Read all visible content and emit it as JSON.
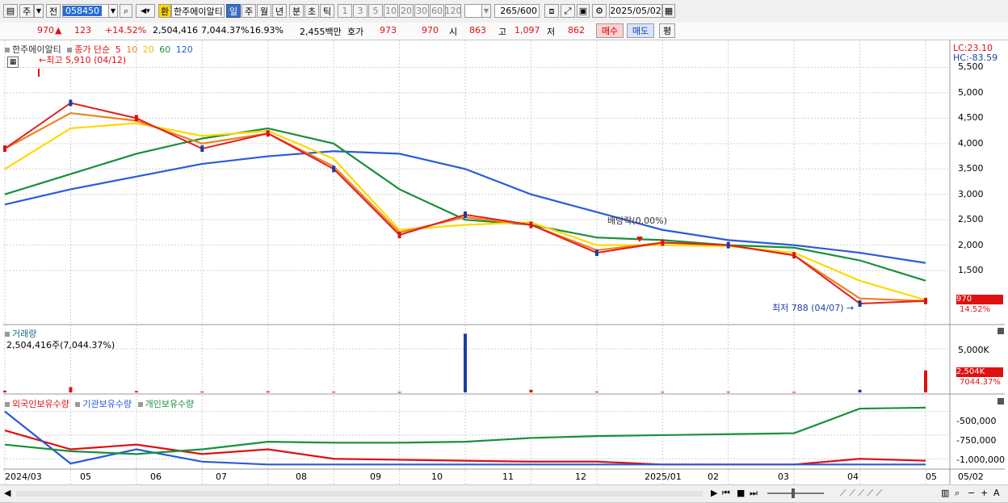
{
  "toolbar": {
    "tab_chart_type": "주",
    "prefix": "전",
    "stock_code": "058450",
    "currency_toggle": "환",
    "stock_name": "한주에이알티",
    "periods": [
      "일",
      "주",
      "월",
      "년",
      "분",
      "초",
      "틱"
    ],
    "selected_period": "일",
    "minute_options": [
      "1",
      "3",
      "5",
      "10",
      "20",
      "30",
      "60",
      "120"
    ],
    "count_value": "265",
    "count_max": "/600",
    "date": "2025/05/02"
  },
  "info": {
    "price": "970",
    "change_arrow": "▲",
    "change": "123",
    "change_pct": "+14.52%",
    "volume": "2,504,416",
    "volume_pct": "7,044.37%",
    "turnover": "16.93%",
    "amount": "2,455백만",
    "quote_label": "호가",
    "ask": "973",
    "bid": "970",
    "open_label": "시",
    "open": "863",
    "high_label": "고",
    "high": "1,097",
    "low_label": "저",
    "low": "862",
    "buy_btn": "매수",
    "sell_btn": "매도",
    "eval_btn": "평"
  },
  "price_panel": {
    "title": "한주에이알티",
    "legend_prefix": "종가 단순",
    "ma_labels": [
      "5",
      "10",
      "20",
      "60",
      "120"
    ],
    "ma_colors": [
      "#e02020",
      "#f08020",
      "#ffd800",
      "#18903a",
      "#2a5adc"
    ],
    "lc_label": "LC:23.10",
    "hc_label": "HC:-83.59",
    "high_annotation": "최고 5,910 (04/12)",
    "low_annotation": "최저 788 (04/07)",
    "dividend_annotation": "배당락(0.00%)",
    "current_price_tag": "970",
    "current_pct_tag": "14.52%",
    "y_ticks": [
      "5,500",
      "5,000",
      "4,500",
      "4,000",
      "3,500",
      "3,000",
      "2,500",
      "2,000",
      "1,500"
    ]
  },
  "volume_panel": {
    "title": "거래량",
    "summary": "2,504,416주(7,044.37%)",
    "y_tick": "5,000K",
    "tag_value": "2,504K",
    "tag_pct": "7044.37%"
  },
  "holding_panel": {
    "legend": [
      "외국인보유수량",
      "기관보유수량",
      "개인보유수량"
    ],
    "legend_colors": [
      "#e01010",
      "#2a5adc",
      "#18903a"
    ],
    "y_ticks": [
      "-500,000",
      "-750,000",
      "-1,000,000"
    ]
  },
  "x_axis": {
    "labels": [
      "2024/03",
      "05",
      "06",
      "07",
      "08",
      "09",
      "10",
      "11",
      "12",
      "2025/01",
      "02",
      "03",
      "04",
      "05"
    ],
    "end_label": "05/02"
  },
  "chart_data": {
    "type": "line",
    "title": "한주에이알티",
    "x": [
      "2024/03",
      "2024/04",
      "2024/05",
      "2024/06",
      "2024/07",
      "2024/08",
      "2024/09",
      "2024/10",
      "2024/11",
      "2024/12",
      "2025/01",
      "2025/02",
      "2025/03",
      "2025/04",
      "2025/05"
    ],
    "series": [
      {
        "name": "5",
        "values": [
          3900,
          4800,
          4500,
          3900,
          4200,
          3500,
          2200,
          2600,
          2400,
          1850,
          2050,
          2000,
          1800,
          850,
          900
        ]
      },
      {
        "name": "10",
        "values": [
          3900,
          4600,
          4450,
          4000,
          4200,
          3550,
          2250,
          2550,
          2400,
          1900,
          2050,
          2000,
          1800,
          950,
          900
        ]
      },
      {
        "name": "20",
        "values": [
          3500,
          4300,
          4400,
          4150,
          4250,
          3700,
          2300,
          2400,
          2450,
          2000,
          2000,
          1980,
          1850,
          1300,
          920
        ]
      },
      {
        "name": "60",
        "values": [
          3000,
          3400,
          3800,
          4100,
          4300,
          4000,
          3100,
          2500,
          2400,
          2150,
          2100,
          2000,
          1950,
          1700,
          1300
        ]
      },
      {
        "name": "120",
        "values": [
          2800,
          3100,
          3350,
          3600,
          3750,
          3850,
          3800,
          3500,
          3000,
          2650,
          2300,
          2100,
          2000,
          1850,
          1650
        ]
      }
    ],
    "volume_k": [
      200,
      600,
      150,
      100,
      120,
      80,
      60,
      6700,
      300,
      90,
      70,
      80,
      60,
      300,
      2504
    ],
    "holdings": [
      {
        "name": "외국인보유수량",
        "values": [
          -700000,
          -900000,
          -850000,
          -950000,
          -900000,
          -1000000,
          -1010000,
          -1020000,
          -1030000,
          -1030000,
          -1060000,
          -1060000,
          -1060000,
          -1000000,
          -1020000
        ]
      },
      {
        "name": "기관보유수량",
        "values": [
          -500000,
          -1050000,
          -900000,
          -1030000,
          -1060000,
          -1060000,
          -1060000,
          -1060000,
          -1060000,
          -1060000,
          -1060000,
          -1060000,
          -1060000,
          -1060000,
          -1060000
        ]
      },
      {
        "name": "개인보유수량",
        "values": [
          -850000,
          -920000,
          -950000,
          -900000,
          -820000,
          -830000,
          -830000,
          -820000,
          -780000,
          -760000,
          -750000,
          -740000,
          -730000,
          -470000,
          -460000
        ]
      }
    ],
    "ylim": [
      788,
      5910
    ],
    "grid": true
  }
}
